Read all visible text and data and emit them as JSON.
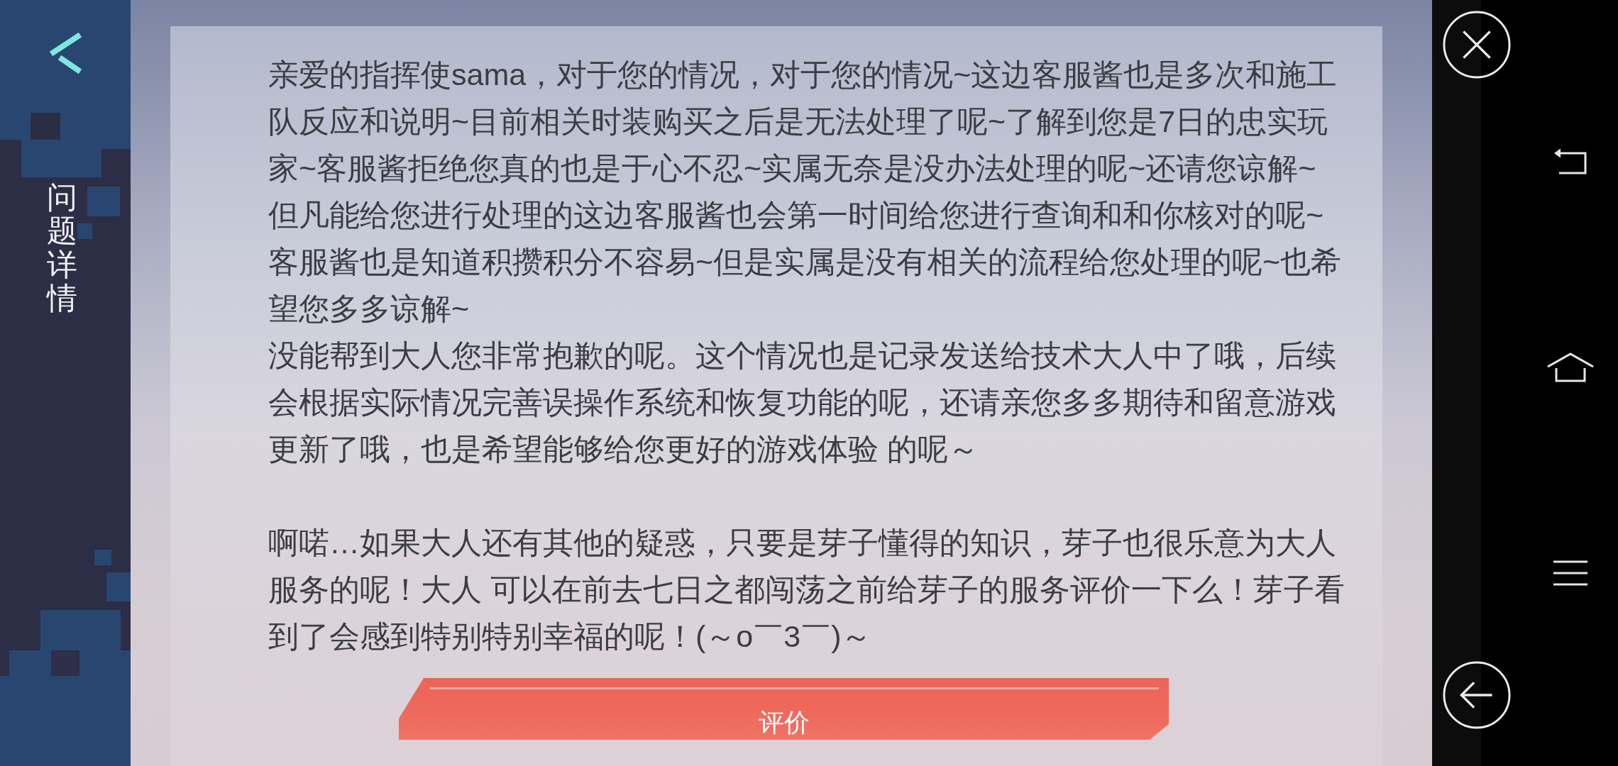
{
  "header": {
    "title": "问题详情"
  },
  "message": {
    "sections": [
      {
        "paragraphs": [
          "亲爱的指挥使sama，对于您的情况，对于您的情况~这边客服酱也是多次和施工队反应和说明~目前相关时装购买之后是无法处理了呢~了解到您是7日的忠实玩家~客服酱拒绝您真的也是于心不忍~实属无奈是没办法处理的呢~还请您谅解~",
          "但凡能给您进行处理的这边客服酱也会第一时间给您进行查询和和你核对的呢~",
          "客服酱也是知道积攒积分不容易~但是实属是没有相关的流程给您处理的呢~也希望您多多谅解~",
          "没能帮到大人您非常抱歉的呢。这个情况也是记录发送给技术大人中了哦，后续会根据实际情况完善误操作系统和恢复功能的呢，还请亲您多多期待和留意游戏更新了哦，也是希望能够给您更好的游戏体验 的呢～"
        ]
      },
      {
        "paragraphs": [
          "啊喏…如果大人还有其他的疑惑，只要是芽子懂得的知识，芽子也很乐意为大人服务的呢！大人 可以在前去七日之都闯荡之前给芽子的服务评价一下么！芽子看到了会感到特别特别幸福的呢！(～o￣3￣)～"
        ]
      }
    ]
  },
  "rate_button": {
    "label": "评价"
  }
}
